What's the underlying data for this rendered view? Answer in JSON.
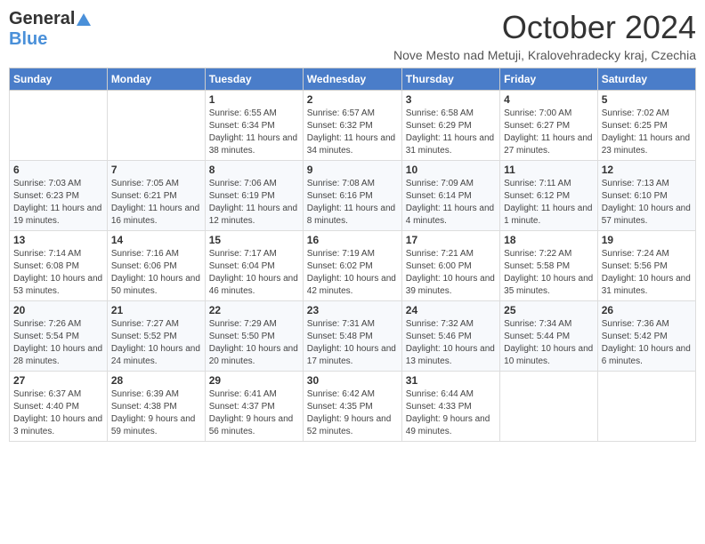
{
  "header": {
    "logo_general": "General",
    "logo_blue": "Blue",
    "month_title": "October 2024",
    "subtitle": "Nove Mesto nad Metuji, Kralovehradecky kraj, Czechia"
  },
  "days_of_week": [
    "Sunday",
    "Monday",
    "Tuesday",
    "Wednesday",
    "Thursday",
    "Friday",
    "Saturday"
  ],
  "weeks": [
    [
      {
        "day": "",
        "info": ""
      },
      {
        "day": "",
        "info": ""
      },
      {
        "day": "1",
        "info": "Sunrise: 6:55 AM\nSunset: 6:34 PM\nDaylight: 11 hours and 38 minutes."
      },
      {
        "day": "2",
        "info": "Sunrise: 6:57 AM\nSunset: 6:32 PM\nDaylight: 11 hours and 34 minutes."
      },
      {
        "day": "3",
        "info": "Sunrise: 6:58 AM\nSunset: 6:29 PM\nDaylight: 11 hours and 31 minutes."
      },
      {
        "day": "4",
        "info": "Sunrise: 7:00 AM\nSunset: 6:27 PM\nDaylight: 11 hours and 27 minutes."
      },
      {
        "day": "5",
        "info": "Sunrise: 7:02 AM\nSunset: 6:25 PM\nDaylight: 11 hours and 23 minutes."
      }
    ],
    [
      {
        "day": "6",
        "info": "Sunrise: 7:03 AM\nSunset: 6:23 PM\nDaylight: 11 hours and 19 minutes."
      },
      {
        "day": "7",
        "info": "Sunrise: 7:05 AM\nSunset: 6:21 PM\nDaylight: 11 hours and 16 minutes."
      },
      {
        "day": "8",
        "info": "Sunrise: 7:06 AM\nSunset: 6:19 PM\nDaylight: 11 hours and 12 minutes."
      },
      {
        "day": "9",
        "info": "Sunrise: 7:08 AM\nSunset: 6:16 PM\nDaylight: 11 hours and 8 minutes."
      },
      {
        "day": "10",
        "info": "Sunrise: 7:09 AM\nSunset: 6:14 PM\nDaylight: 11 hours and 4 minutes."
      },
      {
        "day": "11",
        "info": "Sunrise: 7:11 AM\nSunset: 6:12 PM\nDaylight: 11 hours and 1 minute."
      },
      {
        "day": "12",
        "info": "Sunrise: 7:13 AM\nSunset: 6:10 PM\nDaylight: 10 hours and 57 minutes."
      }
    ],
    [
      {
        "day": "13",
        "info": "Sunrise: 7:14 AM\nSunset: 6:08 PM\nDaylight: 10 hours and 53 minutes."
      },
      {
        "day": "14",
        "info": "Sunrise: 7:16 AM\nSunset: 6:06 PM\nDaylight: 10 hours and 50 minutes."
      },
      {
        "day": "15",
        "info": "Sunrise: 7:17 AM\nSunset: 6:04 PM\nDaylight: 10 hours and 46 minutes."
      },
      {
        "day": "16",
        "info": "Sunrise: 7:19 AM\nSunset: 6:02 PM\nDaylight: 10 hours and 42 minutes."
      },
      {
        "day": "17",
        "info": "Sunrise: 7:21 AM\nSunset: 6:00 PM\nDaylight: 10 hours and 39 minutes."
      },
      {
        "day": "18",
        "info": "Sunrise: 7:22 AM\nSunset: 5:58 PM\nDaylight: 10 hours and 35 minutes."
      },
      {
        "day": "19",
        "info": "Sunrise: 7:24 AM\nSunset: 5:56 PM\nDaylight: 10 hours and 31 minutes."
      }
    ],
    [
      {
        "day": "20",
        "info": "Sunrise: 7:26 AM\nSunset: 5:54 PM\nDaylight: 10 hours and 28 minutes."
      },
      {
        "day": "21",
        "info": "Sunrise: 7:27 AM\nSunset: 5:52 PM\nDaylight: 10 hours and 24 minutes."
      },
      {
        "day": "22",
        "info": "Sunrise: 7:29 AM\nSunset: 5:50 PM\nDaylight: 10 hours and 20 minutes."
      },
      {
        "day": "23",
        "info": "Sunrise: 7:31 AM\nSunset: 5:48 PM\nDaylight: 10 hours and 17 minutes."
      },
      {
        "day": "24",
        "info": "Sunrise: 7:32 AM\nSunset: 5:46 PM\nDaylight: 10 hours and 13 minutes."
      },
      {
        "day": "25",
        "info": "Sunrise: 7:34 AM\nSunset: 5:44 PM\nDaylight: 10 hours and 10 minutes."
      },
      {
        "day": "26",
        "info": "Sunrise: 7:36 AM\nSunset: 5:42 PM\nDaylight: 10 hours and 6 minutes."
      }
    ],
    [
      {
        "day": "27",
        "info": "Sunrise: 6:37 AM\nSunset: 4:40 PM\nDaylight: 10 hours and 3 minutes."
      },
      {
        "day": "28",
        "info": "Sunrise: 6:39 AM\nSunset: 4:38 PM\nDaylight: 9 hours and 59 minutes."
      },
      {
        "day": "29",
        "info": "Sunrise: 6:41 AM\nSunset: 4:37 PM\nDaylight: 9 hours and 56 minutes."
      },
      {
        "day": "30",
        "info": "Sunrise: 6:42 AM\nSunset: 4:35 PM\nDaylight: 9 hours and 52 minutes."
      },
      {
        "day": "31",
        "info": "Sunrise: 6:44 AM\nSunset: 4:33 PM\nDaylight: 9 hours and 49 minutes."
      },
      {
        "day": "",
        "info": ""
      },
      {
        "day": "",
        "info": ""
      }
    ]
  ]
}
